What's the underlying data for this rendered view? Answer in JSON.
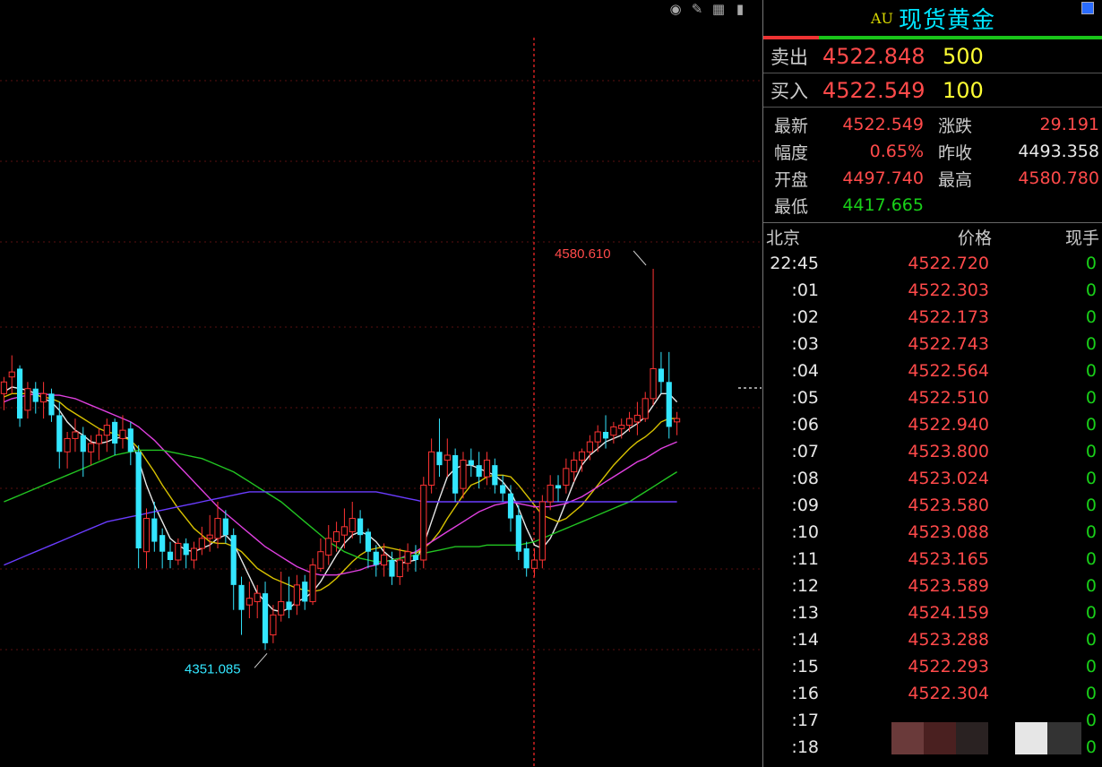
{
  "instrument": {
    "code": "AU",
    "name": "现货黄金"
  },
  "quotes": [
    {
      "label": "卖出",
      "price": "4522.848",
      "volume": "500"
    },
    {
      "label": "买入",
      "price": "4522.549",
      "volume": "100"
    }
  ],
  "stats": [
    {
      "k1": "最新",
      "v1": "4522.549",
      "c1": "red",
      "k2": "涨跌",
      "v2": "29.191",
      "c2": "red"
    },
    {
      "k1": "幅度",
      "v1": "0.65%",
      "c1": "red",
      "k2": "昨收",
      "v2": "4493.358",
      "c2": "white"
    },
    {
      "k1": "开盘",
      "v1": "4497.740",
      "c1": "red",
      "k2": "最高",
      "v2": "4580.780",
      "c2": "red"
    },
    {
      "k1": "最低",
      "v1": "4417.665",
      "c1": "green",
      "k2": "",
      "v2": "",
      "c2": "white"
    }
  ],
  "ticks_header": {
    "time": "北京",
    "price": "价格",
    "volume": "现手"
  },
  "ticks": [
    {
      "time": "22:45",
      "price": "4522.720",
      "volume": "0"
    },
    {
      "time": ":01",
      "price": "4522.303",
      "volume": "0"
    },
    {
      "time": ":02",
      "price": "4522.173",
      "volume": "0"
    },
    {
      "time": ":03",
      "price": "4522.743",
      "volume": "0"
    },
    {
      "time": ":04",
      "price": "4522.564",
      "volume": "0"
    },
    {
      "time": ":05",
      "price": "4522.510",
      "volume": "0"
    },
    {
      "time": ":06",
      "price": "4522.940",
      "volume": "0"
    },
    {
      "time": ":07",
      "price": "4523.800",
      "volume": "0"
    },
    {
      "time": ":08",
      "price": "4523.024",
      "volume": "0"
    },
    {
      "time": ":09",
      "price": "4523.580",
      "volume": "0"
    },
    {
      "time": ":10",
      "price": "4523.088",
      "volume": "0"
    },
    {
      "time": ":11",
      "price": "4523.165",
      "volume": "0"
    },
    {
      "time": ":12",
      "price": "4523.589",
      "volume": "0"
    },
    {
      "time": ":13",
      "price": "4524.159",
      "volume": "0"
    },
    {
      "time": ":14",
      "price": "4523.288",
      "volume": "0"
    },
    {
      "time": ":15",
      "price": "4522.293",
      "volume": "0"
    },
    {
      "time": ":16",
      "price": "4522.304",
      "volume": "0"
    },
    {
      "time": ":17",
      "price": "",
      "volume": "0"
    },
    {
      "time": ":18",
      "price": "",
      "volume": "0"
    }
  ],
  "colors": {
    "up": "#ff3333",
    "down": "#33e6ff",
    "ma5": "#e8e8e8",
    "ma10": "#d8c200",
    "ma20": "#e040e0",
    "ma60": "#22c422",
    "ma120": "#6a3cff",
    "grid": "#5a1010"
  },
  "chart_data": {
    "type": "candlestick",
    "ylim": [
      4300,
      4720
    ],
    "annotations": [
      {
        "text": "4580.610",
        "type": "high",
        "color": "#ff4a4a"
      },
      {
        "text": "4351.085",
        "type": "low",
        "color": "#33e6ff"
      }
    ],
    "candles": [
      [
        4505,
        4512,
        4495,
        4515
      ],
      [
        4515,
        4518,
        4505,
        4528
      ],
      [
        4520,
        4490,
        4485,
        4522
      ],
      [
        4495,
        4508,
        4490,
        4512
      ],
      [
        4508,
        4500,
        4493,
        4512
      ],
      [
        4500,
        4505,
        4490,
        4512
      ],
      [
        4505,
        4492,
        4488,
        4508
      ],
      [
        4492,
        4470,
        4460,
        4500
      ],
      [
        4470,
        4478,
        4460,
        4482
      ],
      [
        4478,
        4482,
        4470,
        4490
      ],
      [
        4480,
        4470,
        4455,
        4485
      ],
      [
        4470,
        4475,
        4462,
        4480
      ],
      [
        4475,
        4480,
        4465,
        4484
      ],
      [
        4480,
        4486,
        4470,
        4490
      ],
      [
        4488,
        4475,
        4468,
        4490
      ],
      [
        4478,
        4483,
        4472,
        4492
      ],
      [
        4484,
        4470,
        4462,
        4488
      ],
      [
        4470,
        4412,
        4400,
        4474
      ],
      [
        4410,
        4430,
        4400,
        4436
      ],
      [
        4430,
        4416,
        4410,
        4440
      ],
      [
        4420,
        4410,
        4400,
        4424
      ],
      [
        4410,
        4405,
        4400,
        4416
      ],
      [
        4405,
        4415,
        4402,
        4418
      ],
      [
        4415,
        4408,
        4400,
        4418
      ],
      [
        4405,
        4412,
        4400,
        4416
      ],
      [
        4412,
        4418,
        4408,
        4425
      ],
      [
        4418,
        4420,
        4410,
        4432
      ],
      [
        4418,
        4430,
        4412,
        4440
      ],
      [
        4430,
        4420,
        4415,
        4435
      ],
      [
        4420,
        4390,
        4375,
        4424
      ],
      [
        4390,
        4375,
        4360,
        4395
      ],
      [
        4378,
        4382,
        4370,
        4392
      ],
      [
        4380,
        4385,
        4370,
        4390
      ],
      [
        4385,
        4355,
        4351,
        4392
      ],
      [
        4360,
        4372,
        4355,
        4378
      ],
      [
        4372,
        4380,
        4368,
        4398
      ],
      [
        4380,
        4375,
        4370,
        4395
      ],
      [
        4378,
        4390,
        4372,
        4396
      ],
      [
        4392,
        4380,
        4375,
        4396
      ],
      [
        4380,
        4402,
        4378,
        4406
      ],
      [
        4400,
        4410,
        4398,
        4418
      ],
      [
        4408,
        4418,
        4402,
        4426
      ],
      [
        4416,
        4422,
        4410,
        4428
      ],
      [
        4420,
        4425,
        4412,
        4436
      ],
      [
        4422,
        4430,
        4418,
        4440
      ],
      [
        4430,
        4420,
        4415,
        4435
      ],
      [
        4422,
        4410,
        4400,
        4424
      ],
      [
        4410,
        4402,
        4395,
        4414
      ],
      [
        4402,
        4408,
        4395,
        4415
      ],
      [
        4405,
        4395,
        4390,
        4410
      ],
      [
        4395,
        4405,
        4390,
        4412
      ],
      [
        4403,
        4410,
        4398,
        4415
      ],
      [
        4408,
        4405,
        4398,
        4414
      ],
      [
        4405,
        4450,
        4400,
        4455
      ],
      [
        4450,
        4470,
        4445,
        4478
      ],
      [
        4470,
        4462,
        4455,
        4490
      ],
      [
        4465,
        4468,
        4455,
        4478
      ],
      [
        4468,
        4445,
        4440,
        4472
      ],
      [
        4448,
        4465,
        4442,
        4470
      ],
      [
        4465,
        4462,
        4455,
        4472
      ],
      [
        4462,
        4455,
        4448,
        4470
      ],
      [
        4455,
        4465,
        4450,
        4470
      ],
      [
        4462,
        4450,
        4445,
        4466
      ],
      [
        4450,
        4445,
        4440,
        4456
      ],
      [
        4445,
        4430,
        4422,
        4450
      ],
      [
        4432,
        4410,
        4405,
        4438
      ],
      [
        4412,
        4400,
        4395,
        4416
      ],
      [
        4400,
        4405,
        4395,
        4412
      ],
      [
        4405,
        4440,
        4400,
        4444
      ],
      [
        4440,
        4450,
        4435,
        4456
      ],
      [
        4450,
        4448,
        4440,
        4456
      ],
      [
        4450,
        4460,
        4445,
        4466
      ],
      [
        4458,
        4465,
        4452,
        4470
      ],
      [
        4465,
        4470,
        4458,
        4472
      ],
      [
        4470,
        4476,
        4465,
        4480
      ],
      [
        4476,
        4482,
        4470,
        4486
      ],
      [
        4482,
        4478,
        4472,
        4492
      ],
      [
        4480,
        4485,
        4475,
        4488
      ],
      [
        4484,
        4486,
        4478,
        4490
      ],
      [
        4486,
        4490,
        4482,
        4494
      ],
      [
        4488,
        4492,
        4480,
        4500
      ],
      [
        4490,
        4502,
        4488,
        4506
      ],
      [
        4502,
        4520,
        4498,
        4580
      ],
      [
        4520,
        4512,
        4505,
        4530
      ],
      [
        4512,
        4485,
        4478,
        4530
      ],
      [
        4488,
        4490,
        4480,
        4494
      ]
    ],
    "series": [
      {
        "name": "MA5",
        "values": [
          4506,
          4509,
          4508,
          4507,
          4505,
          4502,
          4500,
          4495,
          4488,
          4483,
          4480,
          4476,
          4475,
          4476,
          4478,
          4479,
          4478,
          4465,
          4450,
          4438,
          4428,
          4418,
          4414,
          4411,
          4410,
          4412,
          4414,
          4418,
          4420,
          4415,
          4405,
          4395,
          4385,
          4380,
          4375,
          4374,
          4376,
          4380,
          4382,
          4386,
          4392,
          4400,
          4408,
          4415,
          4420,
          4422,
          4420,
          4416,
          4410,
          4406,
          4403,
          4404,
          4405,
          4414,
          4428,
          4442,
          4455,
          4460,
          4462,
          4462,
          4460,
          4458,
          4456,
          4452,
          4446,
          4436,
          4424,
          4414,
          4412,
          4418,
          4428,
          4440,
          4452,
          4462,
          4468,
          4472,
          4476,
          4478,
          4480,
          4484,
          4487,
          4491,
          4498,
          4505,
          4505,
          4500
        ]
      },
      {
        "name": "MA10",
        "values": [
          4503,
          4505,
          4505,
          4505,
          4504,
          4503,
          4502,
          4500,
          4496,
          4493,
          4490,
          4487,
          4484,
          4482,
          4481,
          4479,
          4477,
          4472,
          4465,
          4458,
          4450,
          4443,
          4436,
          4430,
          4424,
          4420,
          4416,
          4415,
          4415,
          4413,
          4410,
          4405,
          4400,
          4397,
          4394,
          4392,
          4390,
          4388,
          4387,
          4386,
          4387,
          4390,
          4394,
          4399,
          4404,
          4408,
          4411,
          4412,
          4413,
          4412,
          4411,
          4410,
          4409,
          4412,
          4416,
          4422,
          4430,
          4437,
          4444,
          4450,
          4452,
          4455,
          4456,
          4456,
          4455,
          4450,
          4444,
          4438,
          4432,
          4430,
          4428,
          4430,
          4434,
          4438,
          4444,
          4450,
          4456,
          4462,
          4467,
          4472,
          4476,
          4479,
          4483,
          4488,
          4490,
          4490
        ]
      },
      {
        "name": "MA20",
        "values": [
          4500,
          4502,
          4503,
          4504,
          4505,
          4505,
          4504,
          4504,
          4503,
          4502,
          4500,
          4498,
          4496,
          4494,
          4492,
          4490,
          4488,
          4485,
          4481,
          4477,
          4472,
          4467,
          4462,
          4457,
          4452,
          4447,
          4442,
          4437,
          4433,
          4429,
          4425,
          4421,
          4417,
          4413,
          4410,
          4407,
          4404,
          4401,
          4399,
          4397,
          4396,
          4396,
          4396,
          4397,
          4398,
          4399,
          4401,
          4402,
          4404,
          4405,
          4406,
          4408,
          4410,
          4413,
          4416,
          4419,
          4422,
          4425,
          4428,
          4431,
          4434,
          4436,
          4438,
          4439,
          4440,
          4439,
          4438,
          4437,
          4437,
          4437,
          4438,
          4439,
          4441,
          4443,
          4446,
          4449,
          4452,
          4455,
          4458,
          4461,
          4464,
          4466,
          4469,
          4472,
          4474,
          4476
        ]
      },
      {
        "name": "MA60",
        "values": [
          4440,
          4442,
          4444,
          4446,
          4448,
          4450,
          4452,
          4454,
          4456,
          4458,
          4460,
          4462,
          4464,
          4466,
          4468,
          4469,
          4470,
          4471,
          4471,
          4471,
          4471,
          4470,
          4469,
          4468,
          4467,
          4466,
          4464,
          4462,
          4460,
          4458,
          4455,
          4452,
          4449,
          4446,
          4443,
          4440,
          4436,
          4432,
          4428,
          4424,
          4420,
          4416,
          4413,
          4410,
          4408,
          4406,
          4405,
          4404,
          4404,
          4405,
          4406,
          4407,
          4408,
          4409,
          4410,
          4411,
          4412,
          4413,
          4413,
          4413,
          4413,
          4414,
          4414,
          4414,
          4414,
          4414,
          4415,
          4416,
          4418,
          4420,
          4422,
          4424,
          4426,
          4428,
          4430,
          4432,
          4434,
          4436,
          4438,
          4440,
          4443,
          4446,
          4449,
          4452,
          4455,
          4458
        ]
      },
      {
        "name": "MA120",
        "values": [
          4402,
          4404,
          4406,
          4408,
          4410,
          4412,
          4414,
          4416,
          4418,
          4420,
          4422,
          4424,
          4426,
          4428,
          4429,
          4430,
          4431,
          4432,
          4433,
          4434,
          4435,
          4436,
          4437,
          4438,
          4439,
          4440,
          4441,
          4442,
          4443,
          4444,
          4445,
          4446,
          4446,
          4446,
          4446,
          4446,
          4446,
          4446,
          4446,
          4446,
          4446,
          4446,
          4446,
          4446,
          4446,
          4446,
          4446,
          4446,
          4445,
          4444,
          4443,
          4442,
          4441,
          4440,
          4440,
          4440,
          4440,
          4440,
          4440,
          4440,
          4440,
          4440,
          4440,
          4440,
          4440,
          4440,
          4440,
          4440,
          4440,
          4440,
          4440,
          4440,
          4440,
          4440,
          4440,
          4440,
          4440,
          4440,
          4440,
          4440,
          4440,
          4440,
          4440,
          4440,
          4440,
          4440
        ]
      }
    ]
  }
}
